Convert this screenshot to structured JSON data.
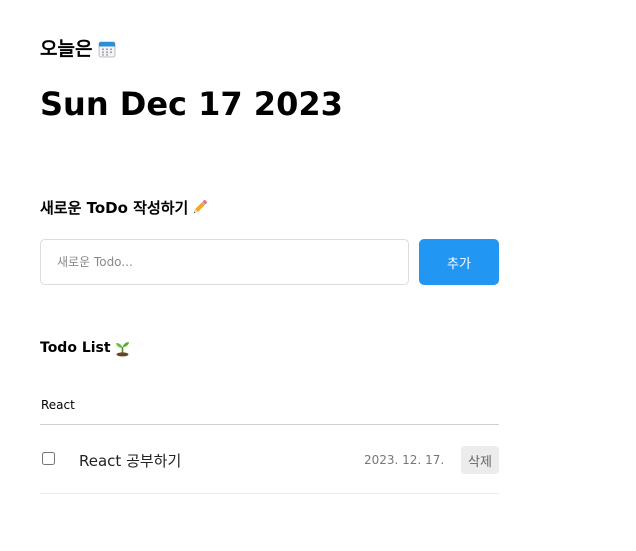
{
  "header": {
    "today_label": "오늘은",
    "date": "Sun Dec 17 2023"
  },
  "editor": {
    "heading": "새로운 ToDo 작성하기",
    "input_placeholder": "새로운 Todo...",
    "input_value": "",
    "add_button_label": "추가"
  },
  "todo_list": {
    "heading": "Todo List",
    "search_value": "React",
    "items": [
      {
        "checked": false,
        "content": "React 공부하기",
        "date": "2023. 12. 17.",
        "delete_label": "삭제"
      }
    ]
  },
  "colors": {
    "accent": "#2196f3",
    "delete_bg": "#ececec",
    "border": "#dcdcdc"
  },
  "icons": {
    "today": "calendar-icon",
    "editor": "pencil-icon",
    "list": "sprout-icon"
  }
}
